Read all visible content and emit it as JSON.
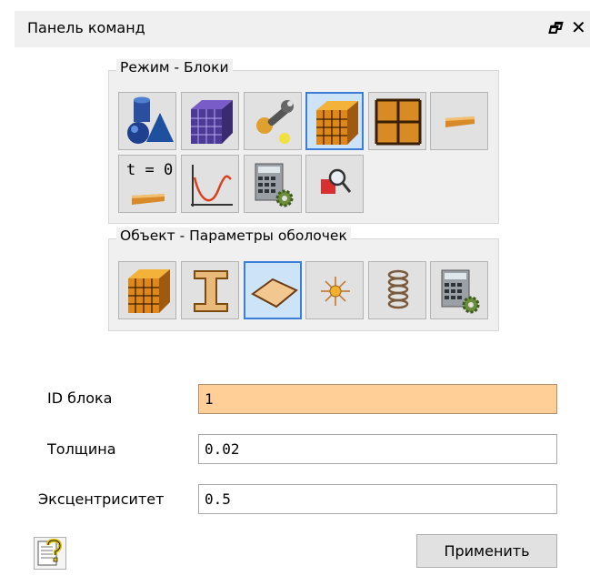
{
  "window": {
    "title": "Панель команд",
    "float_glyph": "🗗",
    "close_glyph": "✕"
  },
  "mode_group": {
    "title": "Режим - Блоки",
    "buttons": [
      {
        "icon": "geometry-shapes-icon",
        "selected": false
      },
      {
        "icon": "purple-mesh-cube-icon",
        "selected": false
      },
      {
        "icon": "wrench-parts-icon",
        "selected": false
      },
      {
        "icon": "orange-block-cube-icon",
        "selected": true
      },
      {
        "icon": "grid-nodes-icon",
        "selected": false
      },
      {
        "icon": "shell-strip-icon",
        "selected": false
      },
      {
        "icon": "initial-conditions-icon",
        "text": "t = 0",
        "selected": false
      },
      {
        "icon": "curve-chart-icon",
        "selected": false
      },
      {
        "icon": "calculator-gear-icon",
        "selected": false
      },
      {
        "icon": "query-magnifier-icon",
        "selected": false
      }
    ]
  },
  "object_group": {
    "title": "Объект - Параметры оболочек",
    "buttons": [
      {
        "icon": "block-cube-icon",
        "selected": false
      },
      {
        "icon": "beam-i-section-icon",
        "selected": false
      },
      {
        "icon": "shell-diamond-icon",
        "selected": true
      },
      {
        "icon": "point-mass-icon",
        "selected": false
      },
      {
        "icon": "spring-coil-icon",
        "selected": false
      },
      {
        "icon": "calculator-gear-icon",
        "selected": false
      }
    ]
  },
  "form": {
    "block_id": {
      "label": "ID блока",
      "value": "1"
    },
    "thickness": {
      "label": "Толщина",
      "value": "0.02"
    },
    "eccentricity": {
      "label": "Эксцентриситет",
      "value": "0.5"
    }
  },
  "actions": {
    "apply_label": "Применить"
  },
  "colors": {
    "highlight_field": "#ffcf97",
    "selected_button": "#cce3f8",
    "selected_border": "#3a7ed8"
  }
}
